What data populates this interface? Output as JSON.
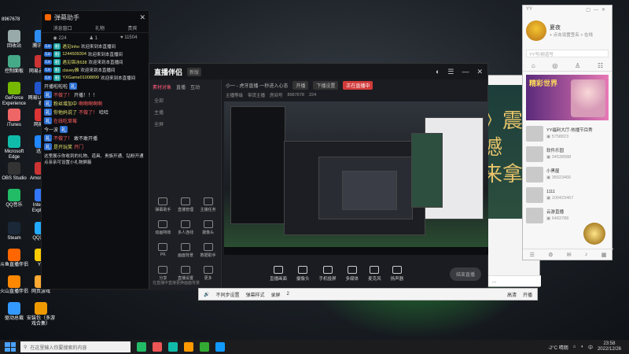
{
  "desktop": {
    "icons": [
      {
        "label": "回收站",
        "color": "#9aa"
      },
      {
        "label": "腾讯QQ",
        "color": "#2d8cf0"
      },
      {
        "label": "控制面板",
        "color": "#4a8"
      },
      {
        "label": "网易云音乐",
        "color": "#c33"
      },
      {
        "label": "GeForce Experience",
        "color": "#76b900"
      },
      {
        "label": "网易UU加速器",
        "color": "#25c"
      },
      {
        "label": "iTunes",
        "color": "#e66"
      },
      {
        "label": "网易云",
        "color": "#d33"
      },
      {
        "label": "Microsoft Edge",
        "color": "#1ba"
      },
      {
        "label": "迅雷",
        "color": "#28f"
      },
      {
        "label": "OBS Studio",
        "color": "#333"
      },
      {
        "label": "Among Us",
        "color": "#c33"
      },
      {
        "label": "QQ音乐",
        "color": "#2b6"
      },
      {
        "label": "Internet Explorer",
        "color": "#37f"
      },
      {
        "label": "Steam",
        "color": "#1b2838"
      },
      {
        "label": "QQ游戏",
        "color": "#2af"
      },
      {
        "label": "斗鱼直播伴侣",
        "color": "#f60"
      },
      {
        "label": "YY",
        "color": "#fc0"
      },
      {
        "label": "火山直播伴侣",
        "color": "#f80"
      },
      {
        "label": "网页游戏",
        "color": "#fa3"
      },
      {
        "label": "驱动总裁",
        "color": "#39f"
      },
      {
        "label": "安装包（多游戏合集）",
        "color": "#e90"
      }
    ],
    "top_left_id": "8967678"
  },
  "chat": {
    "title": "弹幕助手",
    "tabs": [
      "消息窗口",
      "礼物",
      "贵宾"
    ],
    "stats": [
      "224",
      "1",
      "11504"
    ],
    "messages": [
      {
        "name": "遇见Inho",
        "text": "欢迎来到本直播间"
      },
      {
        "name": "1244509304",
        "text": "欢迎来到本直播间"
      },
      {
        "name": "遇见锦冰638",
        "text": "欢迎来到本直播间"
      },
      {
        "name": "clavey雅",
        "text": "欢迎来到本直播间"
      },
      {
        "name": "YXGame01008899",
        "text": "欢迎来到本直播间"
      }
    ],
    "big_messages": [
      {
        "pre": "开播啦啦啦",
        "name": "",
        "text": ""
      },
      {
        "pre": "",
        "name": "",
        "text": "不做了！",
        "extra": "开播！！！"
      },
      {
        "pre": "",
        "name": "粉丝增加中",
        "text": "啊啊啊啊啊"
      },
      {
        "pre": "",
        "name": "你他妈说了",
        "text": "不做了！",
        "extra": "哈哈"
      },
      {
        "pre": "",
        "name": "",
        "text": "在线吃草莓"
      },
      {
        "pre": "今一波",
        "name": "",
        "text": ""
      },
      {
        "pre": "",
        "name": "",
        "text": "不做了！",
        "extra": "敢不敢开播"
      },
      {
        "pre": "",
        "name": "是开玩笑",
        "text": "开门"
      }
    ],
    "notice": "这里展示你收到的礼物、道具、贵族开通、钻粉开通\n点亲亲可设置小礼物屏蔽"
  },
  "app": {
    "logo": "直播伴侣",
    "version": "新版",
    "left_tabs": [
      "素材对象",
      "直播",
      "互动"
    ],
    "left_rows": [
      "全部",
      "主播",
      "全屏"
    ],
    "tools": [
      "弹幕助手",
      "直播管理",
      "主播任务",
      "动画特效",
      "多人连线",
      "摄像头",
      "PK",
      "画面背景",
      "数据助手",
      "分享",
      "直播设置",
      "更多"
    ],
    "bottom_note": "在直播中直接更换画面背景",
    "bar1": {
      "title": "小一 - 虎牙直播·一秒进入心态",
      "pill1": "开播",
      "pill2": "下播设置",
      "red": "正在直播中"
    },
    "bar2": [
      "主播等级",
      "带货主播",
      "房间号",
      "8967678",
      "224"
    ],
    "controls": [
      "直播画面",
      "摄像头",
      "手机投屏",
      "多媒体",
      "麦克风",
      "扬声器"
    ],
    "start_label": "结束直播",
    "mini_items": [
      "视频",
      "预设"
    ]
  },
  "banner": {
    "glyph_line1": "》震撼",
    "glyph_line2": "来拿",
    "bottom_icons": [
      "◀",
      "☺",
      "…"
    ]
  },
  "side": {
    "title": "YY",
    "username": "夏夜",
    "usersub": "+ 点击设置签名 > 在线",
    "search_placeholder": "YY号/频道号",
    "promo_title": "精彩世界",
    "items": [
      {
        "title": "YY福利大厅-热播节目秀",
        "sub": "5758823"
      },
      {
        "title": "软件乐园",
        "sub": "34538988"
      },
      {
        "title": "小黑屋",
        "sub": "38923466"
      },
      {
        "title": "1111",
        "sub": "100423467"
      },
      {
        "title": "云游直播",
        "sub": "6483788"
      }
    ],
    "bottom_icons": [
      "☰",
      "⚙",
      "✉",
      "♪",
      "▦"
    ]
  },
  "bottom_toolbar": {
    "items": [
      "不同步设置",
      "弹幕样式",
      "录屏",
      "2"
    ],
    "right": [
      "高清",
      "开播"
    ]
  },
  "taskbar": {
    "search_placeholder": "在这里输入你要搜索的内容",
    "apps": [
      "#2b6",
      "#e55",
      "#1ba",
      "#f90",
      "#3a3",
      "#19f"
    ],
    "weather": "-2°C 晴朗",
    "lang": "中",
    "time": "23:58",
    "date": "2022/12/26"
  }
}
